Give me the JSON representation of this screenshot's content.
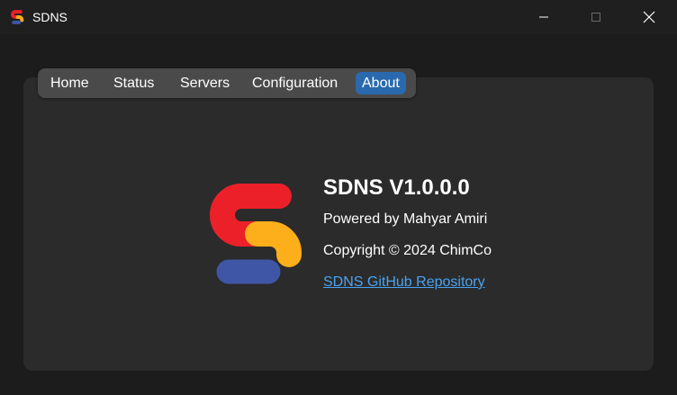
{
  "window": {
    "title": "SDNS",
    "icon": "sdns-logo-icon",
    "controls": [
      "minimize-icon",
      "maximize-icon",
      "close-icon"
    ]
  },
  "tabs": [
    {
      "label": "Home",
      "selected": false
    },
    {
      "label": "Status",
      "selected": false
    },
    {
      "label": "Servers",
      "selected": false
    },
    {
      "label": "Configuration",
      "selected": false
    },
    {
      "label": "About",
      "selected": true
    }
  ],
  "about": {
    "title": "SDNS V1.0.0.0",
    "powered_by": "Powered by Mahyar Amiri",
    "copyright": "Copyright © 2024 ChimCo",
    "link_text": "SDNS GitHub Repository"
  },
  "colors": {
    "accent": "#2a69ad",
    "link": "#4aa3f0",
    "logo_red": "#ec2028",
    "logo_yellow": "#fcaf1b",
    "logo_blue": "#3f56a6"
  }
}
